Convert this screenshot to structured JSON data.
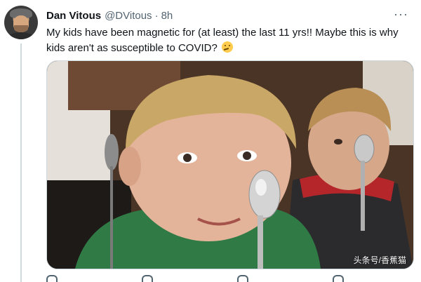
{
  "tweet": {
    "author_name": "Dan Vitous",
    "author_handle": "@DVitous",
    "separator": "·",
    "timestamp": "8h",
    "more_label": "···",
    "text": "My kids have been magnetic for (at least) the last 11 yrs!!  Maybe this is why kids aren't as susceptible to COVID?"
  },
  "media": {
    "description_icon": "photo",
    "watermark": "头条号/香蕉猫"
  },
  "colors": {
    "text": "#0f1419",
    "secondary": "#536471",
    "border": "#cfd9de"
  }
}
